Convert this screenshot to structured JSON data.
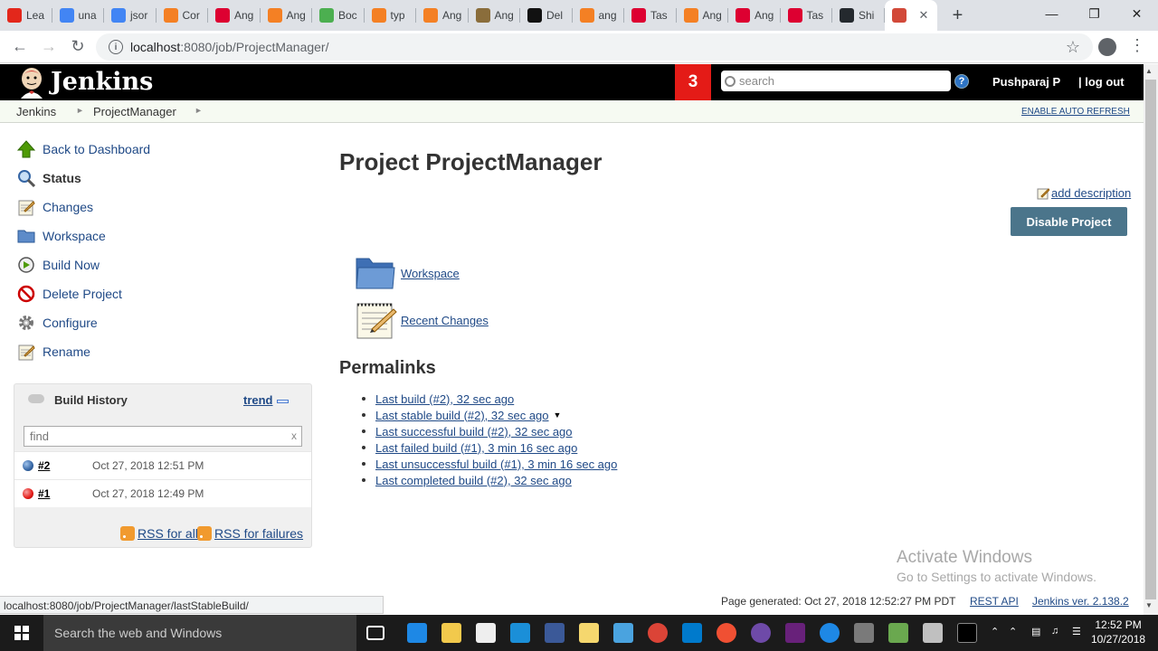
{
  "browser": {
    "tabs": [
      {
        "label": "Lea",
        "icon": "adobe-icon",
        "color": "#e3271b"
      },
      {
        "label": "una",
        "icon": "google-icon",
        "color": "#4285f4"
      },
      {
        "label": "jsor",
        "icon": "google-icon",
        "color": "#4285f4"
      },
      {
        "label": "Cor",
        "icon": "stackoverflow-icon",
        "color": "#f48024"
      },
      {
        "label": "Ang",
        "icon": "angular-icon",
        "color": "#dd0031"
      },
      {
        "label": "Ang",
        "icon": "stackoverflow-icon",
        "color": "#f48024"
      },
      {
        "label": "Boc",
        "icon": "bootstrap-icon",
        "color": "#4caf50"
      },
      {
        "label": "typ",
        "icon": "stackoverflow-icon",
        "color": "#f48024"
      },
      {
        "label": "Ang",
        "icon": "stackoverflow-icon",
        "color": "#f48024"
      },
      {
        "label": "Ang",
        "icon": "grid-icon",
        "color": "#8a6d3b"
      },
      {
        "label": "Del",
        "icon": "github-g-icon",
        "color": "#111111"
      },
      {
        "label": "ang",
        "icon": "stackoverflow-icon",
        "color": "#f48024"
      },
      {
        "label": "Tas",
        "icon": "angular-icon",
        "color": "#dd0031"
      },
      {
        "label": "Ang",
        "icon": "stackoverflow-icon",
        "color": "#f48024"
      },
      {
        "label": "Ang",
        "icon": "angular-icon",
        "color": "#dd0031"
      },
      {
        "label": "Tas",
        "icon": "angular-icon",
        "color": "#dd0031"
      },
      {
        "label": "Shi",
        "icon": "github-icon",
        "color": "#24292e"
      },
      {
        "label": "",
        "icon": "jenkins-icon",
        "color": "#d24939",
        "active": true
      }
    ],
    "url_host": "localhost",
    "url_path": ":8080/job/ProjectManager/"
  },
  "header": {
    "title": "Jenkins",
    "notification_count": "3",
    "search_placeholder": "search",
    "help": "?",
    "user": "Pushparaj P",
    "logout": "| log out"
  },
  "breadcrumb": {
    "items": [
      "Jenkins",
      "ProjectManager"
    ],
    "auto_refresh": "ENABLE AUTO REFRESH"
  },
  "sidebar": {
    "tasks": [
      {
        "label": "Back to Dashboard",
        "icon": "up-arrow-icon"
      },
      {
        "label": "Status",
        "icon": "search-icon"
      },
      {
        "label": "Changes",
        "icon": "notepad-icon"
      },
      {
        "label": "Workspace",
        "icon": "folder-icon"
      },
      {
        "label": "Build Now",
        "icon": "clock-icon"
      },
      {
        "label": "Delete Project",
        "icon": "no-entry-icon"
      },
      {
        "label": "Configure",
        "icon": "gear-icon"
      },
      {
        "label": "Rename",
        "icon": "notepad-icon"
      }
    ]
  },
  "build_history": {
    "title": "Build History",
    "trend": "trend",
    "find_placeholder": "find",
    "find_clear": "x",
    "builds": [
      {
        "number": "#2",
        "date": "Oct 27, 2018 12:51 PM",
        "status": "success",
        "color": "#3465a4"
      },
      {
        "number": "#1",
        "date": "Oct 27, 2018 12:49 PM",
        "status": "failed",
        "color": "#e41b17"
      }
    ],
    "rss_all": "RSS for all",
    "rss_failures": "RSS for failures"
  },
  "main": {
    "title": "Project ProjectManager",
    "add_description": "add description",
    "disable_button": "Disable Project",
    "links": [
      {
        "label": "Workspace",
        "icon": "folder-icon"
      },
      {
        "label": "Recent Changes",
        "icon": "notepad-icon"
      }
    ],
    "permalinks_title": "Permalinks",
    "permalinks": [
      "Last build (#2), 32 sec ago",
      "Last stable build (#2), 32 sec ago",
      "Last successful build (#2), 32 sec ago",
      "Last failed build (#1), 3 min 16 sec ago",
      "Last unsuccessful build (#1), 3 min 16 sec ago",
      "Last completed build (#2), 32 sec ago"
    ]
  },
  "watermark": {
    "line1": "Activate Windows",
    "line2": "Go to Settings to activate Windows."
  },
  "footer": {
    "status_url": "localhost:8080/job/ProjectManager/lastStableBuild/",
    "page_generated": "Page generated: Oct 27, 2018 12:52:27 PM PDT",
    "rest_api": "REST API",
    "version": "Jenkins ver. 2.138.2"
  },
  "taskbar": {
    "search_placeholder": "Search the web and Windows",
    "time": "12:52 PM",
    "date": "10/27/2018"
  }
}
